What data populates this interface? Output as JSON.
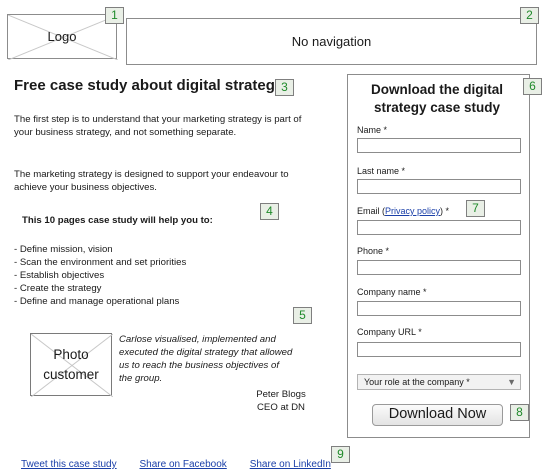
{
  "header": {
    "logo": "Logo",
    "navigation": "No navigation"
  },
  "badges": [
    "1",
    "2",
    "3",
    "4",
    "5",
    "6",
    "7",
    "8",
    "9"
  ],
  "main": {
    "title": "Free case study about digital strategy",
    "paragraphs": [
      "The first step is to understand that your marketing strategy is part of your business strategy, and not something separate.",
      "The marketing strategy is designed to support your endeavour to achieve your business objectives."
    ],
    "list_title": "This 10 pages case study will help you to:",
    "list_items": [
      "- Define mission, vision",
      "- Scan the environment and set priorities",
      "- Establish objectives",
      "- Create the strategy",
      "- Define and manage operational plans"
    ],
    "testimonial": {
      "photo_line1": "Photo",
      "photo_line2": "customer",
      "quote": "Carlose visualised, implemented and executed the digital strategy that allowed us to reach the business objectives of the group.",
      "author": "Peter Blogs",
      "role": "CEO at DN"
    }
  },
  "form": {
    "title": "Download the digital strategy case study",
    "fields": {
      "name": "Name *",
      "last_name": "Last name *",
      "email_prefix": "Email (",
      "email_link": "Privacy policy",
      "email_suffix": ") *",
      "phone": "Phone *",
      "company_name": "Company name *",
      "company_url": "Company URL *"
    },
    "role_select": "Your role at the company  *",
    "submit": "Download Now"
  },
  "share_links": {
    "twitter": "Tweet this case study",
    "facebook": "Share on Facebook",
    "linkedin": "Share on LinkedIn"
  }
}
